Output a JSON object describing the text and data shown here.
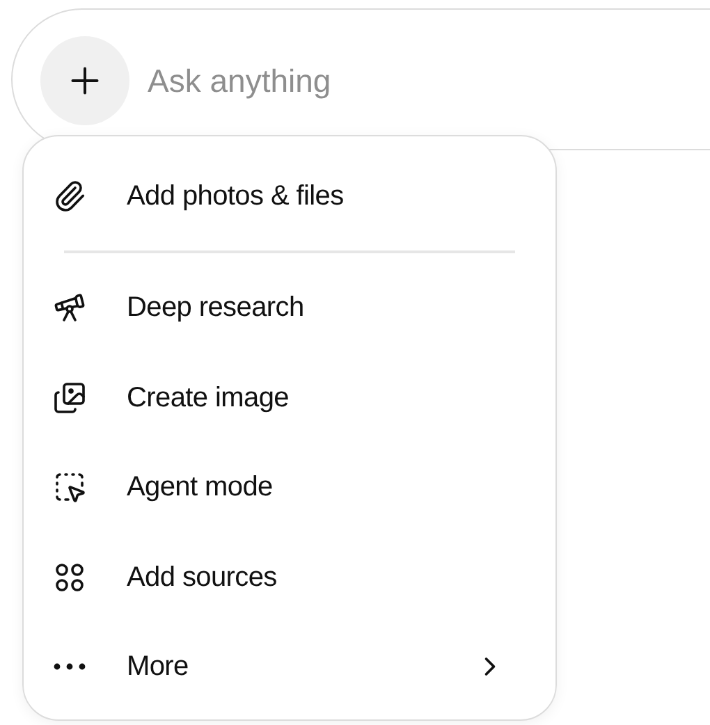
{
  "composer": {
    "placeholder": "Ask anything"
  },
  "menu": {
    "items": [
      {
        "label": "Add photos & files",
        "kind": "action",
        "divider_after": true
      },
      {
        "label": "Deep research",
        "kind": "action",
        "divider_after": false
      },
      {
        "label": "Create image",
        "kind": "action",
        "divider_after": false
      },
      {
        "label": "Agent mode",
        "kind": "action",
        "divider_after": false
      },
      {
        "label": "Add sources",
        "kind": "action",
        "divider_after": false
      },
      {
        "label": "More",
        "kind": "submenu",
        "divider_after": false
      }
    ]
  }
}
